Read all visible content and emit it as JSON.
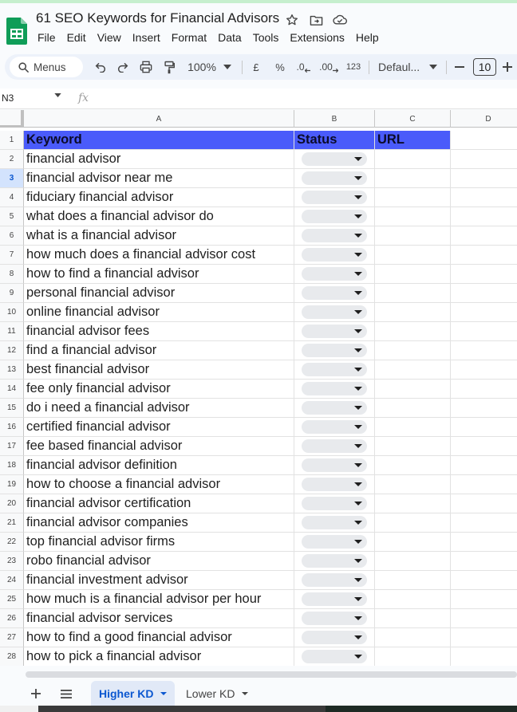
{
  "doc": {
    "title": "61 SEO Keywords for Financial Advisors"
  },
  "menu": [
    "File",
    "Edit",
    "View",
    "Insert",
    "Format",
    "Data",
    "Tools",
    "Extensions",
    "Help"
  ],
  "toolbar": {
    "search_label": "Menus",
    "zoom": "100%",
    "currency": "£",
    "percent": "%",
    "decrease_decimal": ".0",
    "increase_decimal": ".00",
    "number_format": "123",
    "font": "Defaul...",
    "font_size": "10"
  },
  "formula_bar": {
    "cell_ref": "N3",
    "fx": "fx"
  },
  "columns": [
    "A",
    "B",
    "C",
    "D"
  ],
  "header_row": {
    "row_num": "1",
    "keyword": "Keyword",
    "status": "Status",
    "url": "URL"
  },
  "rows": [
    {
      "n": "2",
      "keyword": "financial advisor"
    },
    {
      "n": "3",
      "keyword": "financial advisor near me"
    },
    {
      "n": "4",
      "keyword": "fiduciary financial advisor"
    },
    {
      "n": "5",
      "keyword": "what does a financial advisor do"
    },
    {
      "n": "6",
      "keyword": "what is a financial advisor"
    },
    {
      "n": "7",
      "keyword": "how much does a financial advisor cost"
    },
    {
      "n": "8",
      "keyword": "how to find a financial advisor"
    },
    {
      "n": "9",
      "keyword": "personal financial advisor"
    },
    {
      "n": "10",
      "keyword": "online financial advisor"
    },
    {
      "n": "11",
      "keyword": "financial advisor fees"
    },
    {
      "n": "12",
      "keyword": "find a financial advisor"
    },
    {
      "n": "13",
      "keyword": "best financial advisor"
    },
    {
      "n": "14",
      "keyword": "fee only financial advisor"
    },
    {
      "n": "15",
      "keyword": "do i need a financial advisor"
    },
    {
      "n": "16",
      "keyword": "certified financial advisor"
    },
    {
      "n": "17",
      "keyword": "fee based financial advisor"
    },
    {
      "n": "18",
      "keyword": "financial advisor definition"
    },
    {
      "n": "19",
      "keyword": "how to choose a financial advisor"
    },
    {
      "n": "20",
      "keyword": "financial advisor certification"
    },
    {
      "n": "21",
      "keyword": "financial advisor companies"
    },
    {
      "n": "22",
      "keyword": "top financial advisor firms"
    },
    {
      "n": "23",
      "keyword": "robo financial advisor"
    },
    {
      "n": "24",
      "keyword": "financial investment advisor"
    },
    {
      "n": "25",
      "keyword": "how much is a financial advisor per hour"
    },
    {
      "n": "26",
      "keyword": "financial advisor services"
    },
    {
      "n": "27",
      "keyword": "how to find a good financial advisor"
    },
    {
      "n": "28",
      "keyword": "how to pick a financial advisor"
    }
  ],
  "selected_row": "3",
  "sheets": {
    "tabs": [
      "Higher KD",
      "Lower KD"
    ],
    "active": "Higher KD"
  },
  "colors": {
    "header_fill": "#4a5bfa",
    "accent": "#0b57d0",
    "sheets_green": "#0f9d58"
  }
}
